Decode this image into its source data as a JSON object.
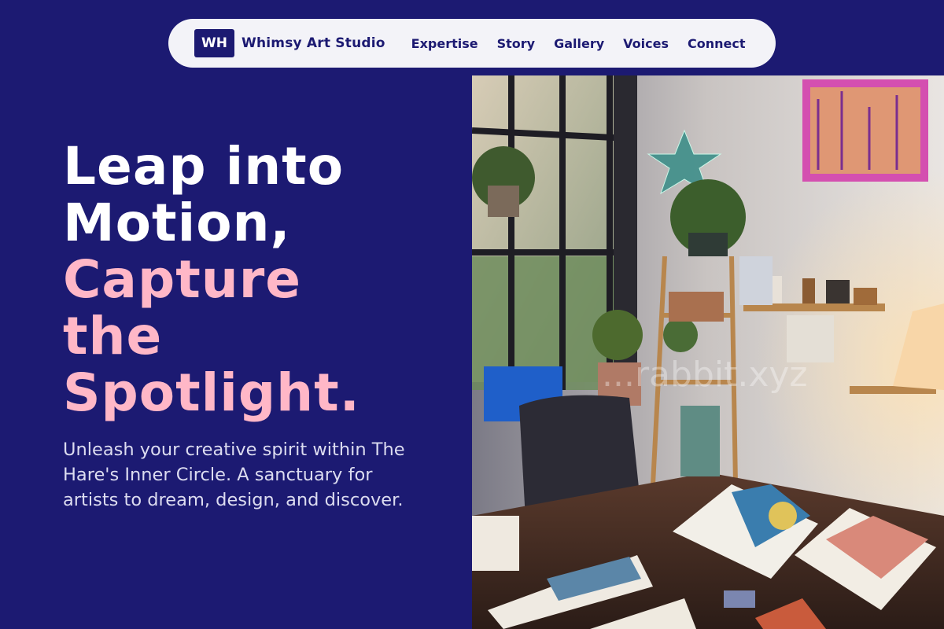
{
  "nav": {
    "logo_initials": "WH",
    "brand": "Whimsy Art Studio",
    "links": [
      "Expertise",
      "Story",
      "Gallery",
      "Voices",
      "Connect"
    ]
  },
  "hero": {
    "headline_white": [
      "Leap into",
      "Motion,"
    ],
    "headline_pink": [
      "Capture",
      "the",
      "Spotlight."
    ],
    "subtitle": "Unleash your creative spirit within The Hare's Inner Circle. A sanctuary for artists to dream, design, and discover."
  },
  "photo": {
    "watermark": "...rabbit.xyz"
  },
  "colors": {
    "background": "#1c1a72",
    "nav_bg": "#f3f3f8",
    "accent_pink": "#ffb7c7"
  }
}
